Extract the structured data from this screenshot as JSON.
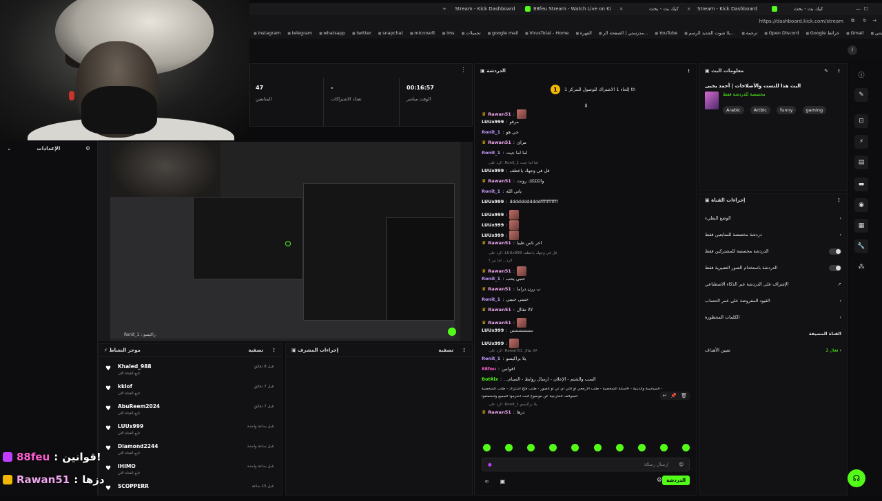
{
  "browser": {
    "tabs": [
      {
        "label": "Stream - Kick Dashboard"
      },
      {
        "label": "88feu Stream - Watch Live on Ki"
      },
      {
        "label": "كيك بث - بحث"
      },
      {
        "label": "Stream - Kick Dashboard"
      },
      {
        "label": "كيك بث - بحث"
      }
    ],
    "url": "https://dashboard.kick.com/stream",
    "bookmarks": [
      "instagram",
      "telegram",
      "whatsapp",
      "twitter",
      "snapchat",
      "microsoft",
      "Ims",
      "تحميلات",
      "google mail",
      "VirusTotal - Home",
      "الفهرة",
      "مدرستي | الصفحة الر...",
      "YouTube",
      "يلا شوت الجديد الرسم...",
      "ترجمة",
      "Open Discord",
      "Google خرائط",
      "Gmail",
      "جيتني"
    ]
  },
  "stats": {
    "followers": {
      "value": "47",
      "label": "المتابعين"
    },
    "subscriptions": {
      "value": "-",
      "label": "تعداد الاشتراكات"
    },
    "live_time": {
      "value": "00:16:57",
      "label": "الوقت مباشر"
    }
  },
  "settings": {
    "title": "الإعدادات"
  },
  "preview": {
    "caption": "Ronit_1 : راكيسو"
  },
  "activity": {
    "title": "موجز النشاط",
    "filter": "تصفية",
    "items": [
      {
        "name": "Khaled_988",
        "sub": "تابع القناة الان",
        "time": "قبل 8 دقائق"
      },
      {
        "name": "kklof",
        "sub": "تابع القناة الان",
        "time": "قبل 7 دقائق"
      },
      {
        "name": "AbuReem2024",
        "sub": "تابع القناة الان",
        "time": "قبل 7 دقائق"
      },
      {
        "name": "LUUx999",
        "sub": "تابع القناة الان",
        "time": "قبل ساعة واحدة"
      },
      {
        "name": "Diamond2244",
        "sub": "تابع القناة الان",
        "time": "قبل ساعة واحدة"
      },
      {
        "name": "IHIMO",
        "sub": "تابع القناة الان",
        "time": "قبل ساعة واحدة"
      },
      {
        "name": "SCOPPERR",
        "sub": "",
        "time": "قبل 15 ساعة"
      }
    ]
  },
  "mod": {
    "title": "إجراءات المشرف",
    "filter": "تصفية"
  },
  "overlay": {
    "line1_user": "88feu",
    "line1_text": "قوانين!",
    "line2_user": "Rawan51",
    "line2_text": "دزها"
  },
  "chat": {
    "title": "الدردشة",
    "goal": "إلحاء 1 الاشتراك للوصول للمركز 1 th",
    "goal_num": "1",
    "messages": [
      {
        "user": "Rawan51",
        "color": "#f0a8f0",
        "crown": true,
        "text": "",
        "img": true
      },
      {
        "user": "LUUx999",
        "color": "#ffffff",
        "text": "مرقو"
      },
      {
        "user": "Ronit_1",
        "color": "#c79cff",
        "text": "حي هو"
      },
      {
        "user": "Rawan51",
        "color": "#f0a8f0",
        "crown": true,
        "text": "مرای"
      },
      {
        "user": "Ronit_1",
        "color": "#c79cff",
        "text": "اما اما جيت"
      },
      {
        "reply": "الرد على :Ronit_1 اما اما جيت"
      },
      {
        "user": "LUUx999",
        "color": "#ffffff",
        "text": "قل في وجهك ياعطف"
      },
      {
        "user": "Rawan51",
        "color": "#f0a8f0",
        "crown": true,
        "text": "والكككك رونت"
      },
      {
        "user": "Ronit_1",
        "color": "#c79cff",
        "text": "ياتي الله"
      },
      {
        "user": "LUUx999",
        "color": "#ffffff",
        "text": "dddddddddddfffffffffff"
      },
      {
        "user": "LUUx999",
        "color": "#ffffff",
        "text": "",
        "img": true
      },
      {
        "user": "LUUx999",
        "color": "#ffffff",
        "text": "",
        "img": true
      },
      {
        "user": "LUUx999",
        "color": "#ffffff",
        "text": "",
        "img": true
      },
      {
        "user": "Rawan51",
        "color": "#f0a8f0",
        "crown": true,
        "text": "اخر ناس طيبا"
      },
      {
        "reply": "الرد على :LUUx999 قل في وجهك ياعطف"
      },
      {
        "reply": "الرد... اما نير ؟"
      },
      {
        "user": "Rawan51",
        "color": "#f0a8f0",
        "crown": true,
        "text": "",
        "img": true
      },
      {
        "user": "Ronit_1",
        "color": "#c79cff",
        "text": "حنبي يحب"
      },
      {
        "user": "Rawan51",
        "color": "#f0a8f0",
        "crown": true,
        "text": "ب ررن.دراما"
      },
      {
        "user": "Ronit_1",
        "color": "#c79cff",
        "text": "حنيني حنيني"
      },
      {
        "user": "Rawan51",
        "color": "#f0a8f0",
        "crown": true,
        "text": "لالا تقاال"
      },
      {
        "user": "Rawan51",
        "color": "#f0a8f0",
        "crown": true,
        "text": "",
        "img": true
      },
      {
        "user": "LUUx999",
        "color": "#ffffff",
        "text": "نننننننننننننننن"
      },
      {
        "user": "LUUx999",
        "color": "#ffffff",
        "text": "",
        "img": true
      },
      {
        "reply": "الرد على :Rawan51 لالا تقاال"
      },
      {
        "user": "Ronit_1",
        "color": "#c79cff",
        "text": "يلا براكيسو"
      },
      {
        "user": "88feu",
        "color": "#ff5fd0",
        "text": "قوانين!"
      },
      {
        "user": "BotRix",
        "color": "#53fc18",
        "text": "...السب والشتم - الإعلان - ارسال روابط - السبام"
      },
      {
        "sys": "السياسية والدينية - الأسئلة الشخصية - طلب الارجعي او التي اي تي او الصور - طلب فتح اشتراك - طلب الشخصية -"
      },
      {
        "sys": "السوالف الخارجية عن موضوع البث احترموا الجميع واستمتعوا"
      },
      {
        "reply": "الرد على :Ronit_1 يلا براكيسو"
      },
      {
        "user": "Rawan51",
        "color": "#f0a8f0",
        "crown": true,
        "text": "دزها"
      }
    ],
    "input_placeholder": "إرسال رسالة",
    "send": "الدردشة"
  },
  "streaminfo": {
    "title": "معلومات البث",
    "stream_title": "البث هذا للتست والأصلاحات | أحمد يحيى",
    "category": "مخصصة للدردشة فقط",
    "tags": [
      "Arabic",
      "Artbic",
      "funny",
      "gaming"
    ]
  },
  "channel_actions": {
    "title": "إجراءات القناة",
    "rows": [
      {
        "label": "الوضع البطيء",
        "kind": "chevron"
      },
      {
        "label": "دردشة مخصصة للمتابعين فقط",
        "kind": "chevron"
      },
      {
        "label": "الدردشة مخصصة للمشتركين فقط",
        "kind": "toggle"
      },
      {
        "label": "الدردشة باستخدام الصور التعبيرية فقط",
        "kind": "toggle"
      },
      {
        "label": "الإشراف على الدردشة عبر الذكاء الاصطناعي",
        "kind": "link"
      },
      {
        "label": "القيود المفروضة على عمر الحساب",
        "kind": "chevron"
      },
      {
        "label": "الكلمات المحظورة",
        "kind": "chevron"
      }
    ],
    "section": "القناة المضيفة",
    "target_label": "تعيين الأهداف",
    "target_value": "فعال 2"
  }
}
